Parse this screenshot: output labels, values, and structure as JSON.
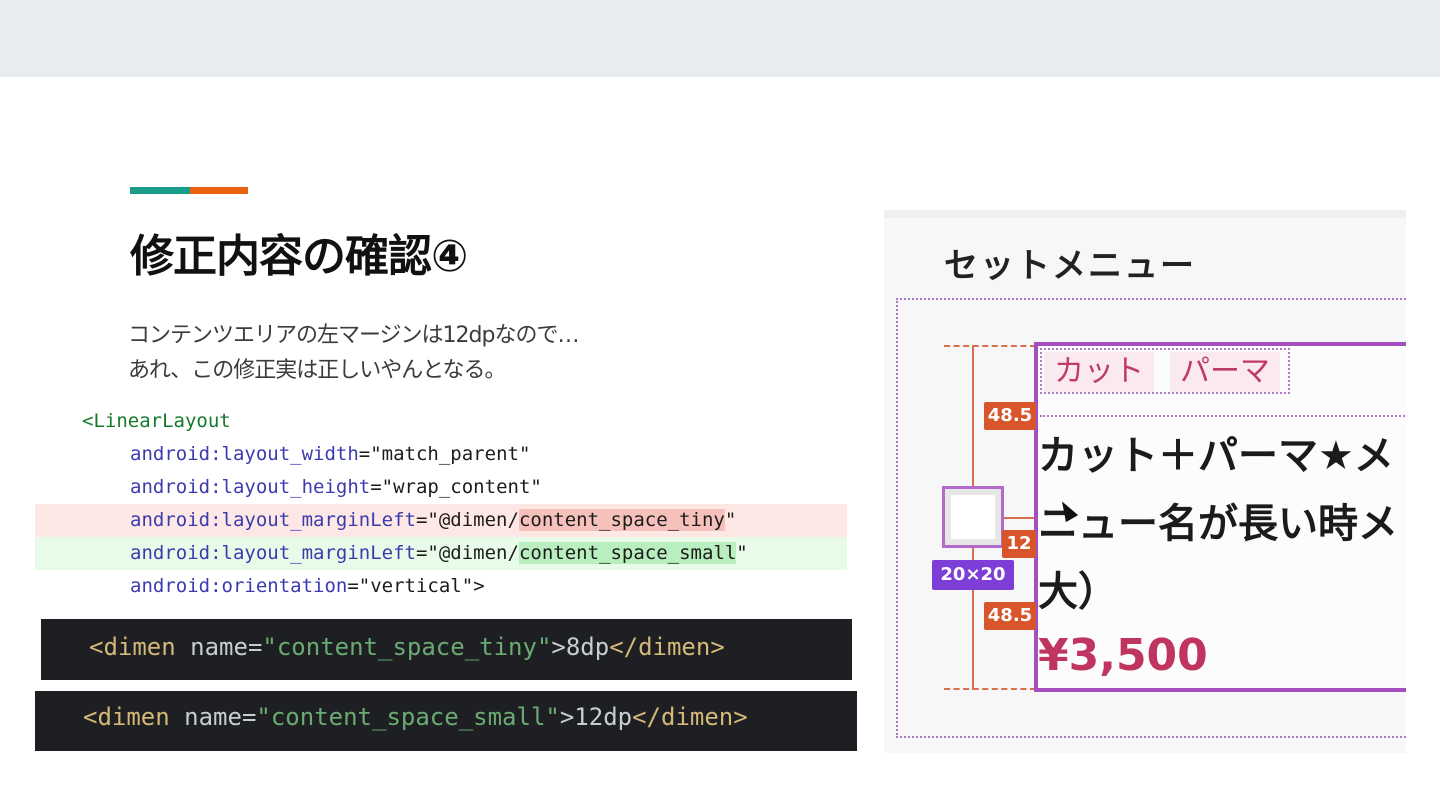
{
  "slide": {
    "title": "修正内容の確認④",
    "body_lines": [
      "コンテンツエリアの左マージンは12dpなので…",
      "あれ、この修正実は正しいやんとなる。"
    ]
  },
  "code_diff": {
    "line1": "<LinearLayout",
    "line2_ns": "android:",
    "line2_attr": "layout_width",
    "line2_val": "=\"match_parent\"",
    "line3_ns": "android:",
    "line3_attr": "layout_height",
    "line3_val": "=\"wrap_content\"",
    "line4_ns": "android:",
    "line4_attr": "layout_marginLeft",
    "line4_pre": "=\"@dimen/",
    "line4_hl": "content_space_tiny",
    "line4_post": "\"",
    "line5_ns": "android:",
    "line5_attr": "layout_marginLeft",
    "line5_pre": "=\"@dimen/",
    "line5_hl": "content_space_small",
    "line5_post": "\"",
    "line6_ns": "android:",
    "line6_attr": "orientation",
    "line6_val": "=\"vertical\">"
  },
  "dimen_tiny": {
    "open": "<dimen",
    "attr": " name=",
    "value": "\"content_space_tiny\"",
    "text": ">8dp",
    "close": "</dimen>"
  },
  "dimen_small": {
    "open": "<dimen",
    "attr": " name=",
    "value": "\"content_space_small\"",
    "text": ">12dp",
    "close": "</dimen>"
  },
  "screenshot": {
    "header": "セットメニュー",
    "chips": [
      "カット",
      "パーマ"
    ],
    "menu_name_lines": [
      "カット＋パーマ★メ",
      "ニュー名が長い時メ",
      "大）"
    ],
    "price": "¥3,500",
    "badges": {
      "top_margin": "48.5",
      "left_margin": "12",
      "bottom_margin": "48.5",
      "size": "20×20"
    }
  },
  "colors": {
    "accent_teal": "#1a9c8a",
    "accent_orange": "#e8610f",
    "removed_bg": "#fde8e6",
    "added_bg": "#e8fbe9",
    "price": "#c0355f",
    "badge": "#d8542b",
    "size_badge": "#7c3ed6"
  }
}
